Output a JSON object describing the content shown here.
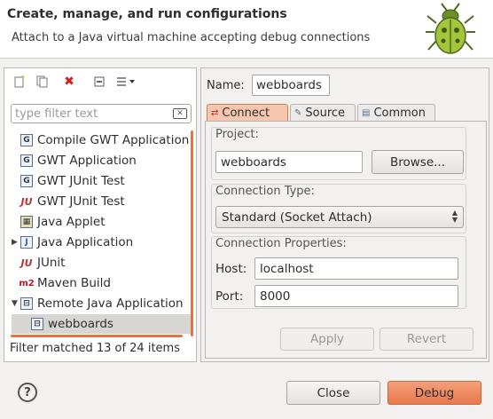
{
  "header": {
    "title": "Create, manage, and run configurations",
    "subtitle": "Attach to a Java virtual machine accepting debug connections",
    "logo_icon": "bug-icon"
  },
  "toolbar": {
    "buttons": [
      "new-configuration-icon",
      "duplicate-icon",
      "delete-icon",
      "collapse-all-icon",
      "filter-icon"
    ],
    "delete_color": "#cc2222"
  },
  "filter": {
    "placeholder": "type filter text"
  },
  "tree": {
    "items": [
      {
        "label": "Compile GWT Application",
        "icon": "gwt-compile-icon"
      },
      {
        "label": "GWT Application",
        "icon": "gwt-icon"
      },
      {
        "label": "GWT JUnit Test",
        "icon": "gwt-junit-icon"
      },
      {
        "label": "GWT JUnit Test",
        "icon": "junit-icon"
      },
      {
        "label": "Java Applet",
        "icon": "applet-icon"
      },
      {
        "label": "Java Application",
        "icon": "java-app-icon",
        "expandable": true
      },
      {
        "label": "JUnit",
        "icon": "junit-icon"
      },
      {
        "label": "Maven Build",
        "icon": "maven-icon"
      },
      {
        "label": "Remote Java Application",
        "icon": "remote-java-icon",
        "expanded": true
      },
      {
        "label": "webboards",
        "icon": "remote-config-icon",
        "selected": true
      }
    ],
    "status": "Filter matched 13 of 24 items"
  },
  "config": {
    "name_label": "Name:",
    "name_value": "webboards",
    "tabs": [
      {
        "label": "Connect",
        "icon": "connect-icon",
        "active": true
      },
      {
        "label": "Source",
        "icon": "source-icon"
      },
      {
        "label": "Common",
        "icon": "common-icon"
      }
    ],
    "project_label": "Project:",
    "project_value": "webboards",
    "browse_label": "Browse...",
    "connection_type_label": "Connection Type:",
    "connection_type_value": "Standard (Socket Attach)",
    "connection_props_label": "Connection Properties:",
    "host_label": "Host:",
    "host_value": "localhost",
    "port_label": "Port:",
    "port_value": "8000",
    "apply_label": "Apply",
    "revert_label": "Revert"
  },
  "footer": {
    "help_icon": "help-icon",
    "close_label": "Close",
    "debug_label": "Debug"
  },
  "colors": {
    "accent": "#e8784b",
    "selection": "#d8d6d3"
  }
}
